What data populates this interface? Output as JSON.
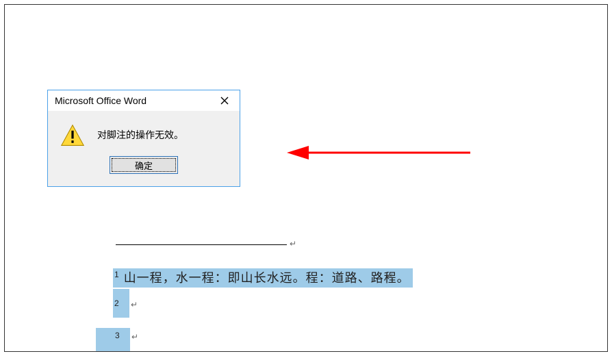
{
  "dialog": {
    "title": "Microsoft Office Word",
    "message": "对脚注的操作无效。",
    "ok_label": "确定",
    "icon": "warning-icon",
    "close_icon": "close-icon"
  },
  "footnotes": {
    "separator": "———",
    "items": [
      {
        "num": "1",
        "text": "山一程，水一程：即山长水远。程：道路、路程。",
        "pilcrow": "↵"
      },
      {
        "num": "2",
        "text": "",
        "pilcrow": "↵"
      },
      {
        "num": "3",
        "text": "",
        "pilcrow": "↵"
      }
    ]
  },
  "annotation": {
    "arrow_color": "#ff0000"
  }
}
